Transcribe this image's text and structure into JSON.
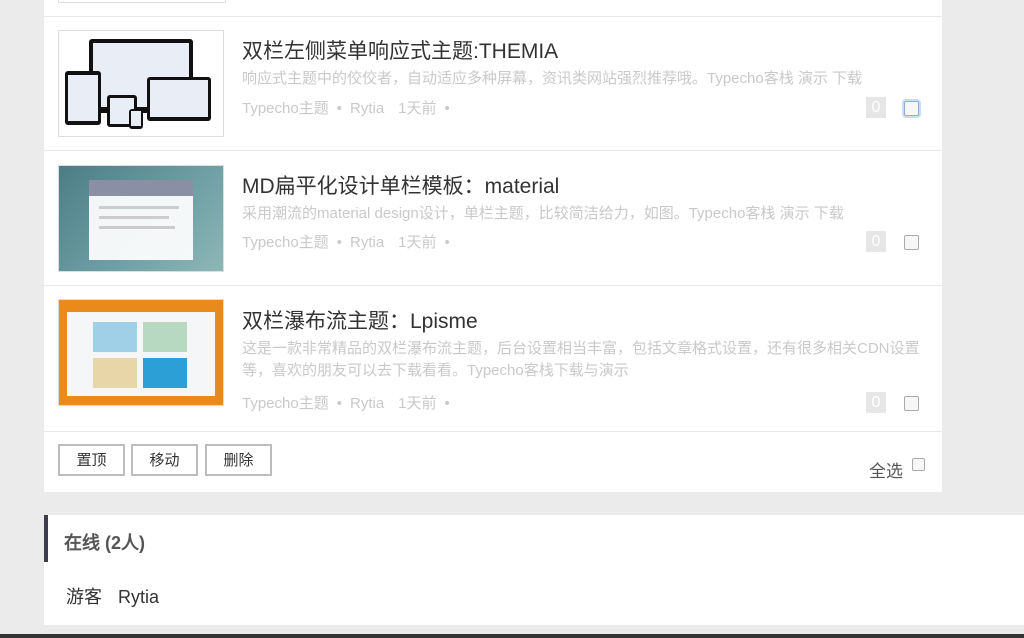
{
  "posts": [
    {
      "title": "双栏左侧菜单响应式主题:THEMIA",
      "desc": "响应式主题中的佼佼者，自动适应多种屏幕，资讯类网站强烈推荐哦。Typecho客栈 演示 下载",
      "category": "Typecho主题",
      "author": "Rytia",
      "time": "1天前",
      "comments": "0"
    },
    {
      "title": "MD扁平化设计单栏模板：material",
      "desc": "采用潮流的material design设计，单栏主题，比较简洁给力，如图。Typecho客栈 演示 下载",
      "category": "Typecho主题",
      "author": "Rytia",
      "time": "1天前",
      "comments": "0"
    },
    {
      "title": "双栏瀑布流主题：Lpisme",
      "desc": "这是一款非常精品的双栏瀑布流主题，后台设置相当丰富，包括文章格式设置，还有很多相关CDN设置等，喜欢的朋友可以去下载看看。Typecho客栈下载与演示",
      "category": "Typecho主题",
      "author": "Rytia",
      "time": "1天前",
      "comments": "0"
    }
  ],
  "meta_separator": "•",
  "actions": {
    "pin": "置顶",
    "move": "移动",
    "delete": "删除",
    "select_all": "全选"
  },
  "online": {
    "title": "在线 (2人)",
    "users": [
      "游客",
      "Rytia"
    ]
  }
}
